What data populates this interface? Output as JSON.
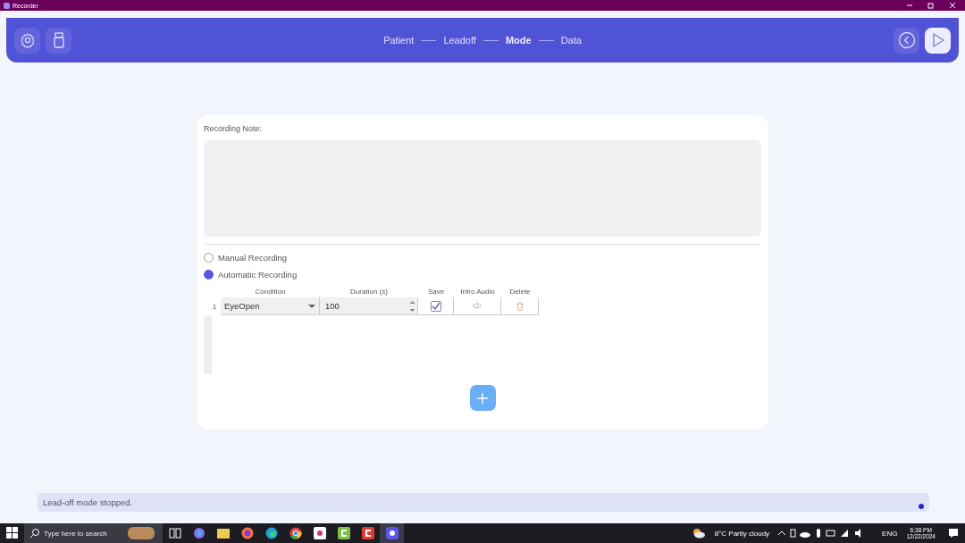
{
  "window": {
    "title": "Recorder"
  },
  "steps": [
    {
      "label": "Patient",
      "selected": false
    },
    {
      "label": "Leadoff",
      "selected": false
    },
    {
      "label": "Mode",
      "selected": true
    },
    {
      "label": "Data",
      "selected": false
    }
  ],
  "note": {
    "label": "Recording Note:"
  },
  "modes": [
    {
      "label": "Manual Recording",
      "selected": false
    },
    {
      "label": "Automatic Recording",
      "selected": true
    }
  ],
  "table": {
    "columns": [
      "Condition",
      "Duration (s)",
      "Save",
      "Intro Audio",
      "Delete"
    ],
    "rows": [
      {
        "index": "1",
        "condition": "EyeOpen",
        "duration": "100",
        "save": true
      }
    ]
  },
  "status_bar": {
    "message": "Lead-off mode stopped."
  },
  "taskbar": {
    "search": {
      "placeholder": "Type here to search"
    },
    "weather": "8°C  Partly cloudy",
    "language": "ENG",
    "time": "6:38 PM",
    "date": "12/22/2024"
  }
}
